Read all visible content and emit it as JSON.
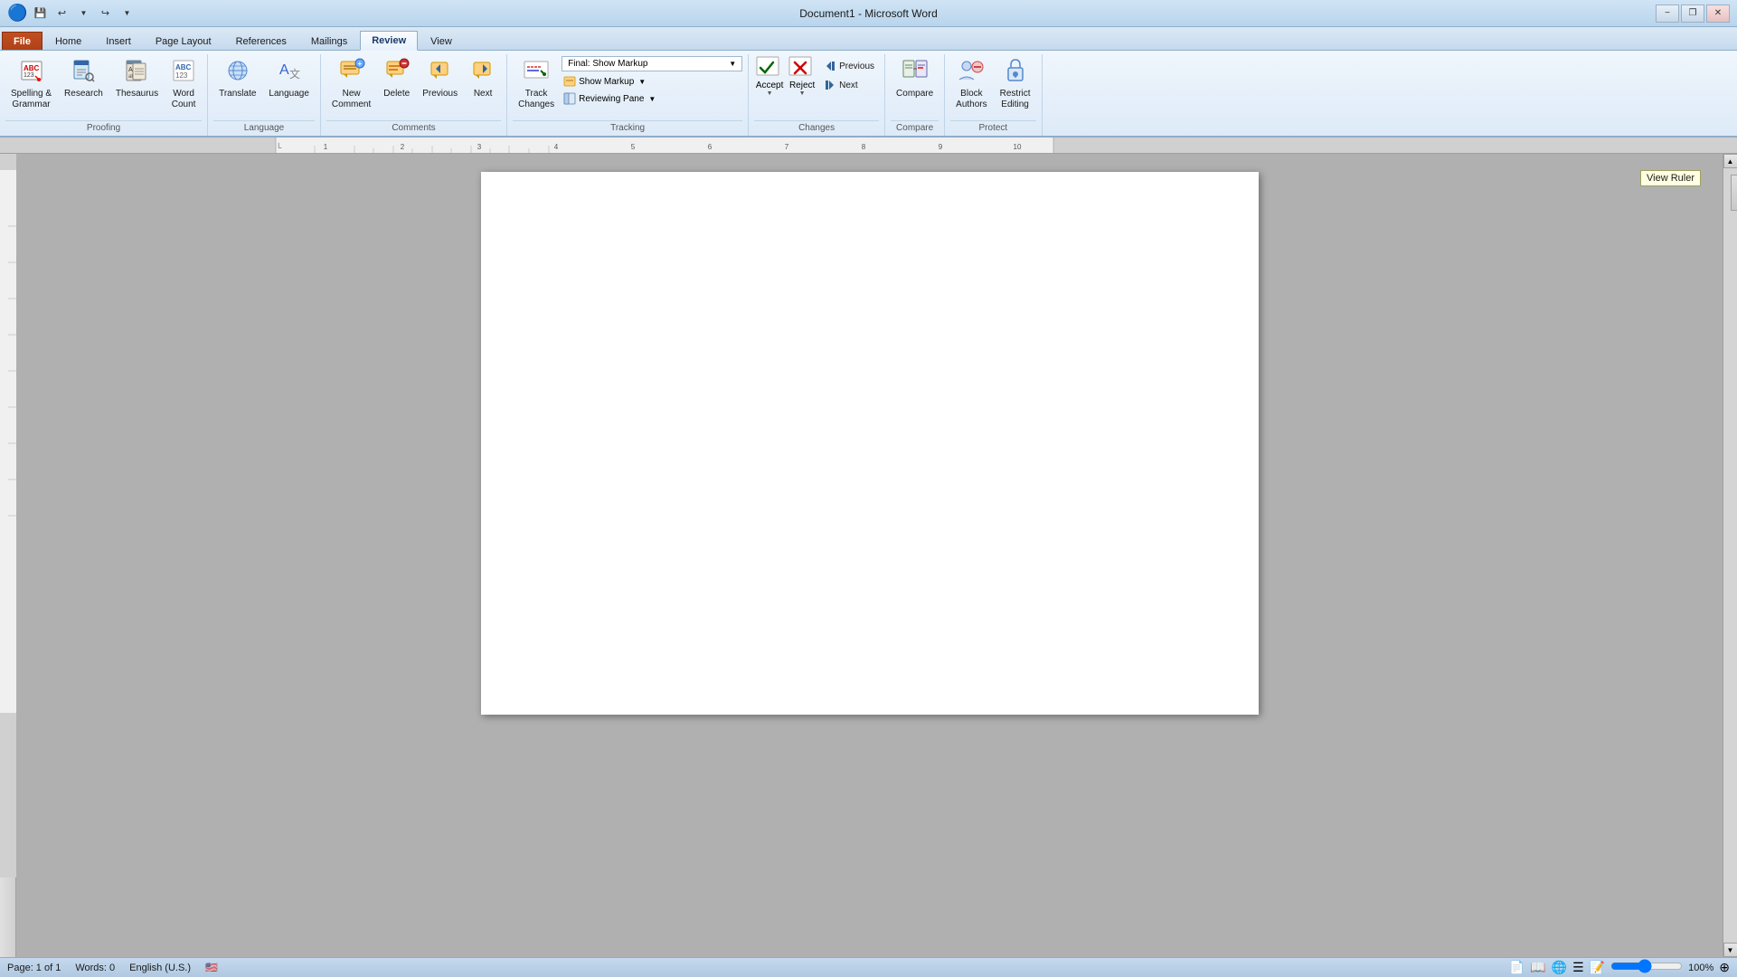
{
  "titlebar": {
    "title": "Document1 - Microsoft Word",
    "minimize": "−",
    "restore": "❐",
    "close": "✕",
    "qat_save": "💾",
    "qat_undo": "↩",
    "qat_redo": "↪",
    "qat_more": "▼"
  },
  "tabs": [
    {
      "label": "File",
      "active": false
    },
    {
      "label": "Home",
      "active": false
    },
    {
      "label": "Insert",
      "active": false
    },
    {
      "label": "Page Layout",
      "active": false
    },
    {
      "label": "References",
      "active": false
    },
    {
      "label": "Mailings",
      "active": false
    },
    {
      "label": "Review",
      "active": true
    },
    {
      "label": "View",
      "active": false
    }
  ],
  "ribbon": {
    "groups": [
      {
        "name": "Proofing",
        "buttons": [
          {
            "id": "spelling",
            "icon": "🔤",
            "label": "Spelling &\nGrammar"
          },
          {
            "id": "research",
            "icon": "📖",
            "label": "Research"
          },
          {
            "id": "thesaurus",
            "icon": "📚",
            "label": "Thesaurus"
          },
          {
            "id": "wordcount",
            "icon": "🔢",
            "label": "Word\nCount"
          }
        ]
      },
      {
        "name": "Language",
        "buttons": [
          {
            "id": "translate",
            "icon": "🌐",
            "label": "Translate"
          },
          {
            "id": "language",
            "icon": "🗣",
            "label": "Language"
          }
        ]
      },
      {
        "name": "Comments",
        "buttons": [
          {
            "id": "newcomment",
            "icon": "💬",
            "label": "New\nComment"
          },
          {
            "id": "delete",
            "icon": "🗑",
            "label": "Delete"
          },
          {
            "id": "prev-comment",
            "icon": "◀",
            "label": "Previous"
          },
          {
            "id": "next-comment",
            "icon": "▶",
            "label": "Next"
          }
        ]
      },
      {
        "name": "Tracking",
        "dropdown_label": "Final: Show Markup",
        "show_markup": "Show Markup",
        "reviewing_pane": "Reviewing Pane",
        "track_changes_label": "Track\nChanges"
      },
      {
        "name": "Changes",
        "buttons": [
          {
            "id": "accept",
            "icon": "✔",
            "label": "Accept"
          },
          {
            "id": "reject",
            "icon": "✖",
            "label": "Reject"
          }
        ],
        "prev_label": "Previous",
        "next_label": "Next"
      },
      {
        "name": "Compare",
        "buttons": [
          {
            "id": "compare",
            "icon": "⚖",
            "label": "Compare"
          }
        ]
      },
      {
        "name": "Protect",
        "buttons": [
          {
            "id": "block-authors",
            "icon": "👥",
            "label": "Block\nAuthors"
          },
          {
            "id": "restrict-editing",
            "icon": "🔒",
            "label": "Restrict\nEditing"
          }
        ]
      }
    ]
  },
  "tooltip": {
    "text": "View Ruler"
  },
  "statusbar": {
    "page": "Page: 1 of 1",
    "words": "Words: 0",
    "language": "English (U.S.)",
    "zoom_level": "100%",
    "view_print": "🖨",
    "view_fullscreen": "⛶",
    "view_web": "🌐",
    "view_outline": "☰",
    "view_draft": "📄"
  }
}
